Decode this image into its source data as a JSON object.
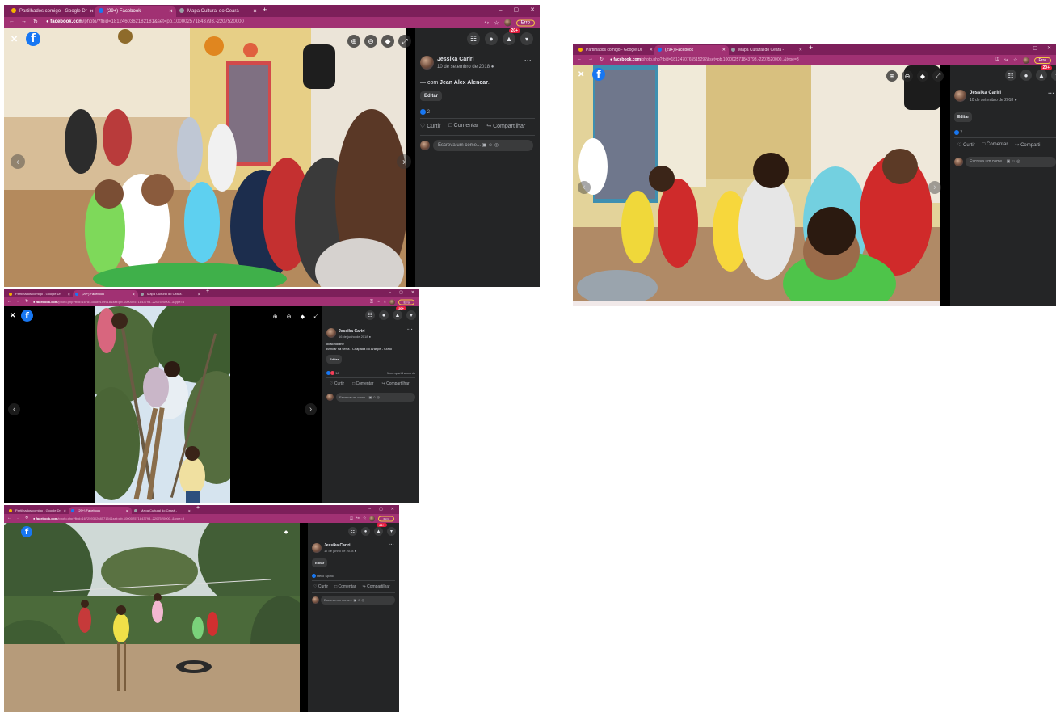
{
  "browser": {
    "tabs": [
      "Partilhados comigo - Google Dr",
      "(29+) Facebook",
      "Mapa Cultural do Ceará -"
    ],
    "new_tab": "+",
    "profile_pill": "Erro",
    "window_controls": [
      "–",
      "▢",
      "✕"
    ]
  },
  "viewer": {
    "close_glyph": "✕",
    "logo_letter": "f",
    "prev_glyph": "‹",
    "next_glyph": "›",
    "notification_badge": "20+"
  },
  "screens": [
    {
      "url_host": "facebook.com",
      "url_path": "/photo/?fbid=1812460362182181&set=pb.100002571843793.-2207520000",
      "author": "Jessika Cariri",
      "date": "10 de setembro de 2018",
      "caption_prefix": "— com ",
      "caption_bold": "Jean Alex Alencar",
      "caption_suffix": ".",
      "edit_label": "Editar",
      "reactions_count": "2",
      "share_count": "",
      "actions": [
        "Curtir",
        "Comentar",
        "Compartilhar"
      ],
      "comment_placeholder": "Escreva um come..."
    },
    {
      "url_host": "facebook.com",
      "url_path": "/photo.php?fbid=1812470765515292&set=pb.100002571843793.-2207520000..&type=3",
      "author": "Jessika Cariri",
      "date": "10 de setembro de 2018",
      "caption_prefix": "",
      "caption_bold": "",
      "caption_suffix": "",
      "edit_label": "Editar",
      "reactions_count": "7",
      "share_count": "",
      "actions": [
        "Curtir",
        "Comentar",
        "Comparti"
      ],
      "comment_placeholder": "Escreva um come..."
    },
    {
      "url_host": "facebook.com",
      "url_path": "/photo.php?fbid=1678435689159918&set=pb.100002571843793.-2207520000..&type=3",
      "author": "Jessika Cariri",
      "date": "16 de junho de 2018",
      "caption_prefix": "#calondiarte\nBrincar na serra - Chapada do Araripe - Crato",
      "caption_bold": "",
      "caption_suffix": "",
      "edit_label": "Editar",
      "reactions_count": "16",
      "share_count": "1 compartilhamento",
      "actions": [
        "Curtir",
        "Comentar",
        "Compartilhar"
      ],
      "comment_placeholder": "Escreva um come..."
    },
    {
      "url_host": "facebook.com",
      "url_path": "/photo.php?fbid=1672593026857154&set=pb.100002571843793.-2207520000..&type=3",
      "author": "Jessika Cariri",
      "date": "17 de junho de 2018",
      "caption_prefix": "",
      "caption_bold": "",
      "caption_suffix": "",
      "edit_label": "Editar",
      "reactions_count": "Hello Spotio",
      "share_count": "",
      "actions": [
        "Curtir",
        "Comentar",
        "Compartilhar"
      ],
      "comment_placeholder": "Escreva um come..."
    }
  ],
  "colors": {
    "tab_bar": "#7d1f5a",
    "address_bar": "#a13173",
    "fb_dark": "#242526",
    "fb_blue": "#1877f2",
    "badge_red": "#e41e3f"
  }
}
